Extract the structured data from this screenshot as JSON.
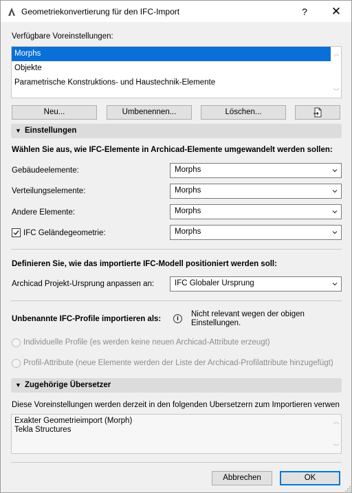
{
  "window": {
    "title": "Geometriekonvertierung für den IFC-Import",
    "help": "?",
    "close": "✕"
  },
  "presets": {
    "label": "Verfügbare Voreinstellungen:",
    "items": [
      {
        "label": "Morphs",
        "selected": true
      },
      {
        "label": "Objekte",
        "selected": false
      },
      {
        "label": "Parametrische Konstruktions- und Haustechnik-Elemente",
        "selected": false
      }
    ],
    "buttons": {
      "new": "Neu...",
      "rename": "Umbenennen...",
      "delete": "Löschen..."
    }
  },
  "settings": {
    "header": "Einstellungen",
    "convert_heading": "Wählen Sie aus, wie IFC-Elemente in Archicad-Elemente umgewandelt werden sollen:",
    "rows": [
      {
        "label": "Gebäudeelemente:",
        "value": "Morphs"
      },
      {
        "label": "Verteilungselemente:",
        "value": "Morphs"
      },
      {
        "label": "Andere Elemente:",
        "value": "Morphs"
      },
      {
        "label": "IFC Geländegeometrie:",
        "value": "Morphs",
        "checked": true
      }
    ],
    "position_heading": "Definieren Sie, wie das importierte IFC-Modell positioniert werden soll:",
    "origin_label": "Archicad Projekt-Ursprung anpassen an:",
    "origin_value": "IFC Globaler Ursprung",
    "profiles_label": "Unbenannte IFC-Profile importieren als:",
    "profiles_info_line1": "Nicht relevant wegen der obigen",
    "profiles_info_line2": "Einstellungen.",
    "radio1": "Individuelle Profile (es werden keine neuen Archicad-Attribute erzeugt)",
    "radio2": "Profil-Attribute (neue Elemente werden der Liste der Archicad-Profilattribute hinzugefügt)"
  },
  "translators": {
    "header": "Zugehörige Übersetzer",
    "description": "Diese Voreinstellungen werden derzeit in den folgenden Übersetzern zum Importieren verwen",
    "line1": "Exakter Geometrieimport (Morph)",
    "line2": "Tekla Structures"
  },
  "footer": {
    "cancel": "Abbrechen",
    "ok": "OK"
  }
}
